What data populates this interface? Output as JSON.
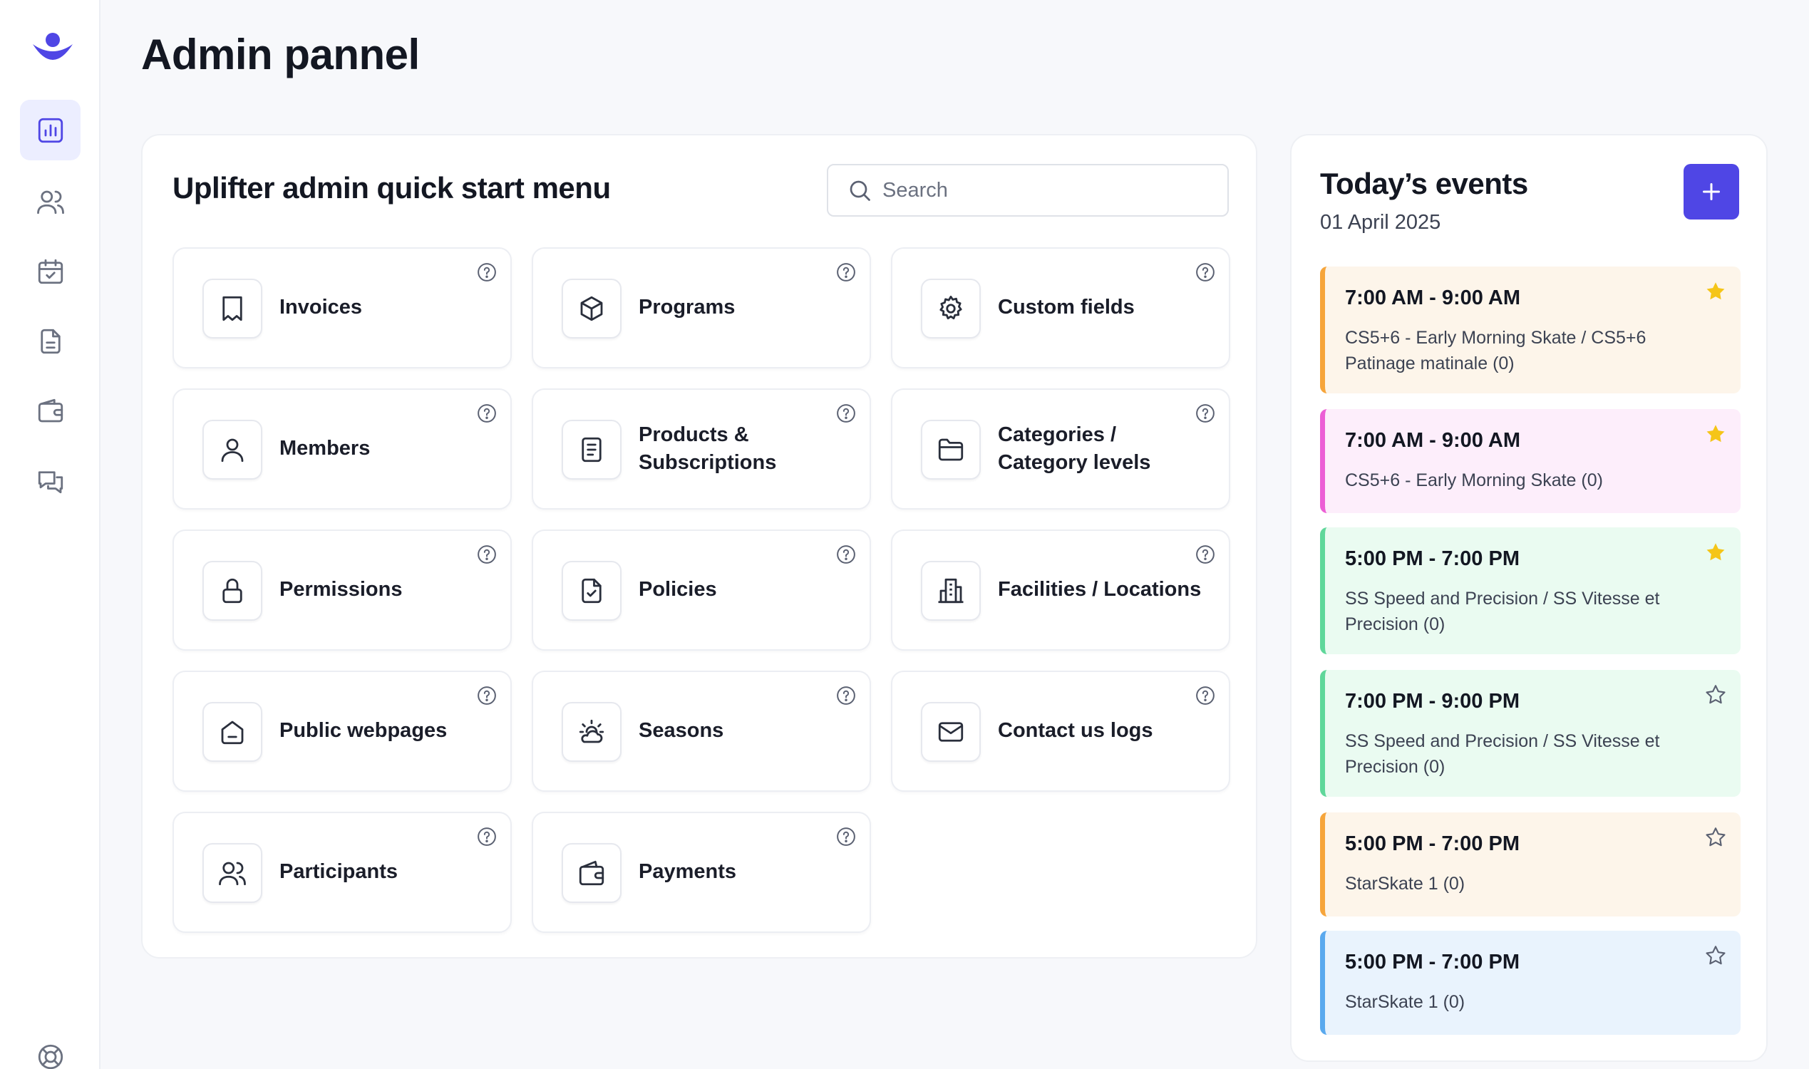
{
  "app": {
    "title": "Admin pannel"
  },
  "sidebar": {
    "items": [
      {
        "name": "dashboard",
        "icon": "bar-chart-icon",
        "active": true
      },
      {
        "name": "users",
        "icon": "users-icon",
        "active": false
      },
      {
        "name": "calendar",
        "icon": "calendar-check-icon",
        "active": false
      },
      {
        "name": "documents",
        "icon": "document-icon",
        "active": false
      },
      {
        "name": "wallet",
        "icon": "wallet-icon",
        "active": false
      },
      {
        "name": "messages",
        "icon": "chat-icon",
        "active": false
      },
      {
        "name": "support",
        "icon": "lifebuoy-icon",
        "active": false
      }
    ]
  },
  "quick_start": {
    "title": "Uplifter admin quick start menu",
    "search_placeholder": "Search",
    "cards": [
      {
        "label": "Invoices",
        "icon": "receipt-icon"
      },
      {
        "label": "Programs",
        "icon": "box-icon"
      },
      {
        "label": "Custom fields",
        "icon": "gear-icon"
      },
      {
        "label": "Members",
        "icon": "user-icon"
      },
      {
        "label": "Products & Subscriptions",
        "icon": "list-document-icon"
      },
      {
        "label": "Categories / Category levels",
        "icon": "folder-icon"
      },
      {
        "label": "Permissions",
        "icon": "lock-icon"
      },
      {
        "label": "Policies",
        "icon": "file-check-icon"
      },
      {
        "label": "Facilities / Locations",
        "icon": "building-icon"
      },
      {
        "label": "Public webpages",
        "icon": "home-icon"
      },
      {
        "label": "Seasons",
        "icon": "sun-cloud-icon"
      },
      {
        "label": "Contact us logs",
        "icon": "mail-icon"
      },
      {
        "label": "Participants",
        "icon": "users-icon"
      },
      {
        "label": "Payments",
        "icon": "wallet-icon"
      }
    ]
  },
  "events": {
    "title": "Today’s events",
    "date": "01 April 2025",
    "add_label": "+",
    "items": [
      {
        "time": "7:00 AM - 9:00 AM",
        "desc": "CS5+6 - Early Morning Skate / CS5+6 Patinage matinale (0)",
        "starred": true,
        "bg": "#fdf5ea",
        "accent": "#f6a53b"
      },
      {
        "time": "7:00 AM - 9:00 AM",
        "desc": "CS5+6 - Early Morning Skate (0)",
        "starred": true,
        "bg": "#fdeefb",
        "accent": "#ec5fd5"
      },
      {
        "time": "5:00 PM - 7:00 PM",
        "desc": "SS Speed and Precision / SS Vitesse et Precision (0)",
        "starred": true,
        "bg": "#eafbf1",
        "accent": "#5fd79a"
      },
      {
        "time": "7:00 PM - 9:00 PM",
        "desc": "SS Speed and Precision / SS Vitesse et Precision (0)",
        "starred": false,
        "bg": "#eafbf1",
        "accent": "#5fd79a"
      },
      {
        "time": "5:00 PM - 7:00 PM",
        "desc": "StarSkate 1 (0)",
        "starred": false,
        "bg": "#fdf5ea",
        "accent": "#f6a53b"
      },
      {
        "time": "5:00 PM - 7:00 PM",
        "desc": "StarSkate 1 (0)",
        "starred": false,
        "bg": "#e9f3fd",
        "accent": "#5aa9ee"
      }
    ]
  },
  "colors": {
    "brand": "#4f46e5",
    "star": "#f5c518"
  }
}
